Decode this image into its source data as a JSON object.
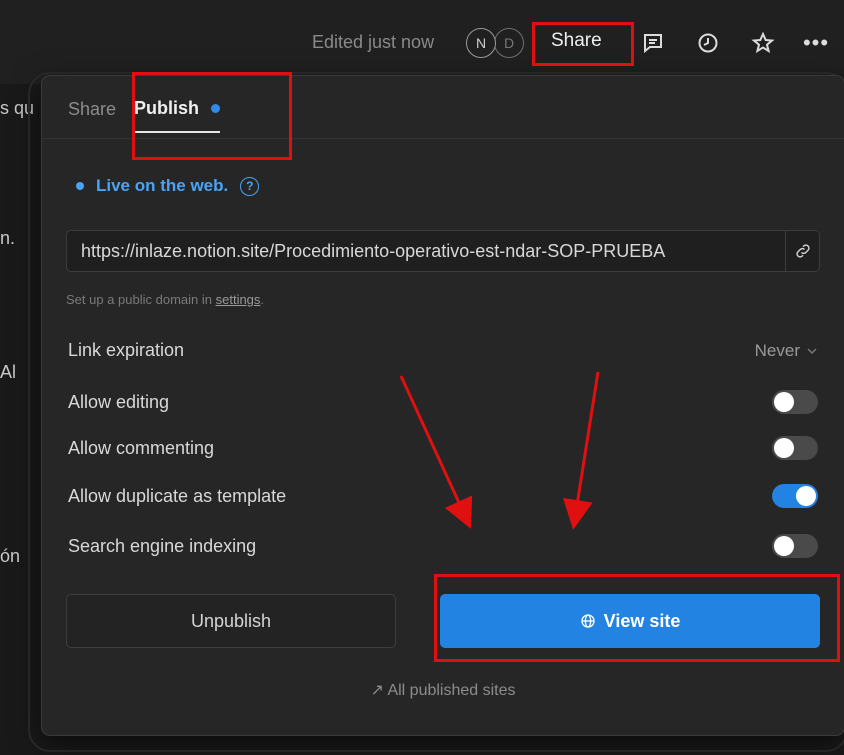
{
  "topbar": {
    "edited_label": "Edited just now",
    "avatars": [
      "N",
      "D"
    ],
    "share_label": "Share",
    "icons": [
      "comment-icon",
      "history-icon",
      "star-icon",
      "more-icon"
    ]
  },
  "background_text": [
    "s qu",
    "n.",
    "Al",
    "ón"
  ],
  "panel": {
    "tabs": [
      {
        "label": "Share",
        "active": false
      },
      {
        "label": "Publish",
        "active": true
      }
    ],
    "live_label": "Live on the web.",
    "url": "https://inlaze.notion.site/Procedimiento-operativo-est-ndar-SOP-PRUEBA",
    "hint_prefix": "Set up a public domain in ",
    "hint_link": "settings",
    "hint_suffix": ".",
    "link_expiration": {
      "label": "Link expiration",
      "value": "Never"
    },
    "options": [
      {
        "label": "Allow editing",
        "on": false
      },
      {
        "label": "Allow commenting",
        "on": false
      },
      {
        "label": "Allow duplicate as template",
        "on": true
      },
      {
        "label": "Search engine indexing",
        "on": false
      }
    ],
    "unpublish_label": "Unpublish",
    "view_site_label": "View site",
    "all_sites_label": "All published sites"
  },
  "colors": {
    "accent": "#2383e2",
    "live": "#4aa3f5",
    "annotation": "#e01010"
  }
}
